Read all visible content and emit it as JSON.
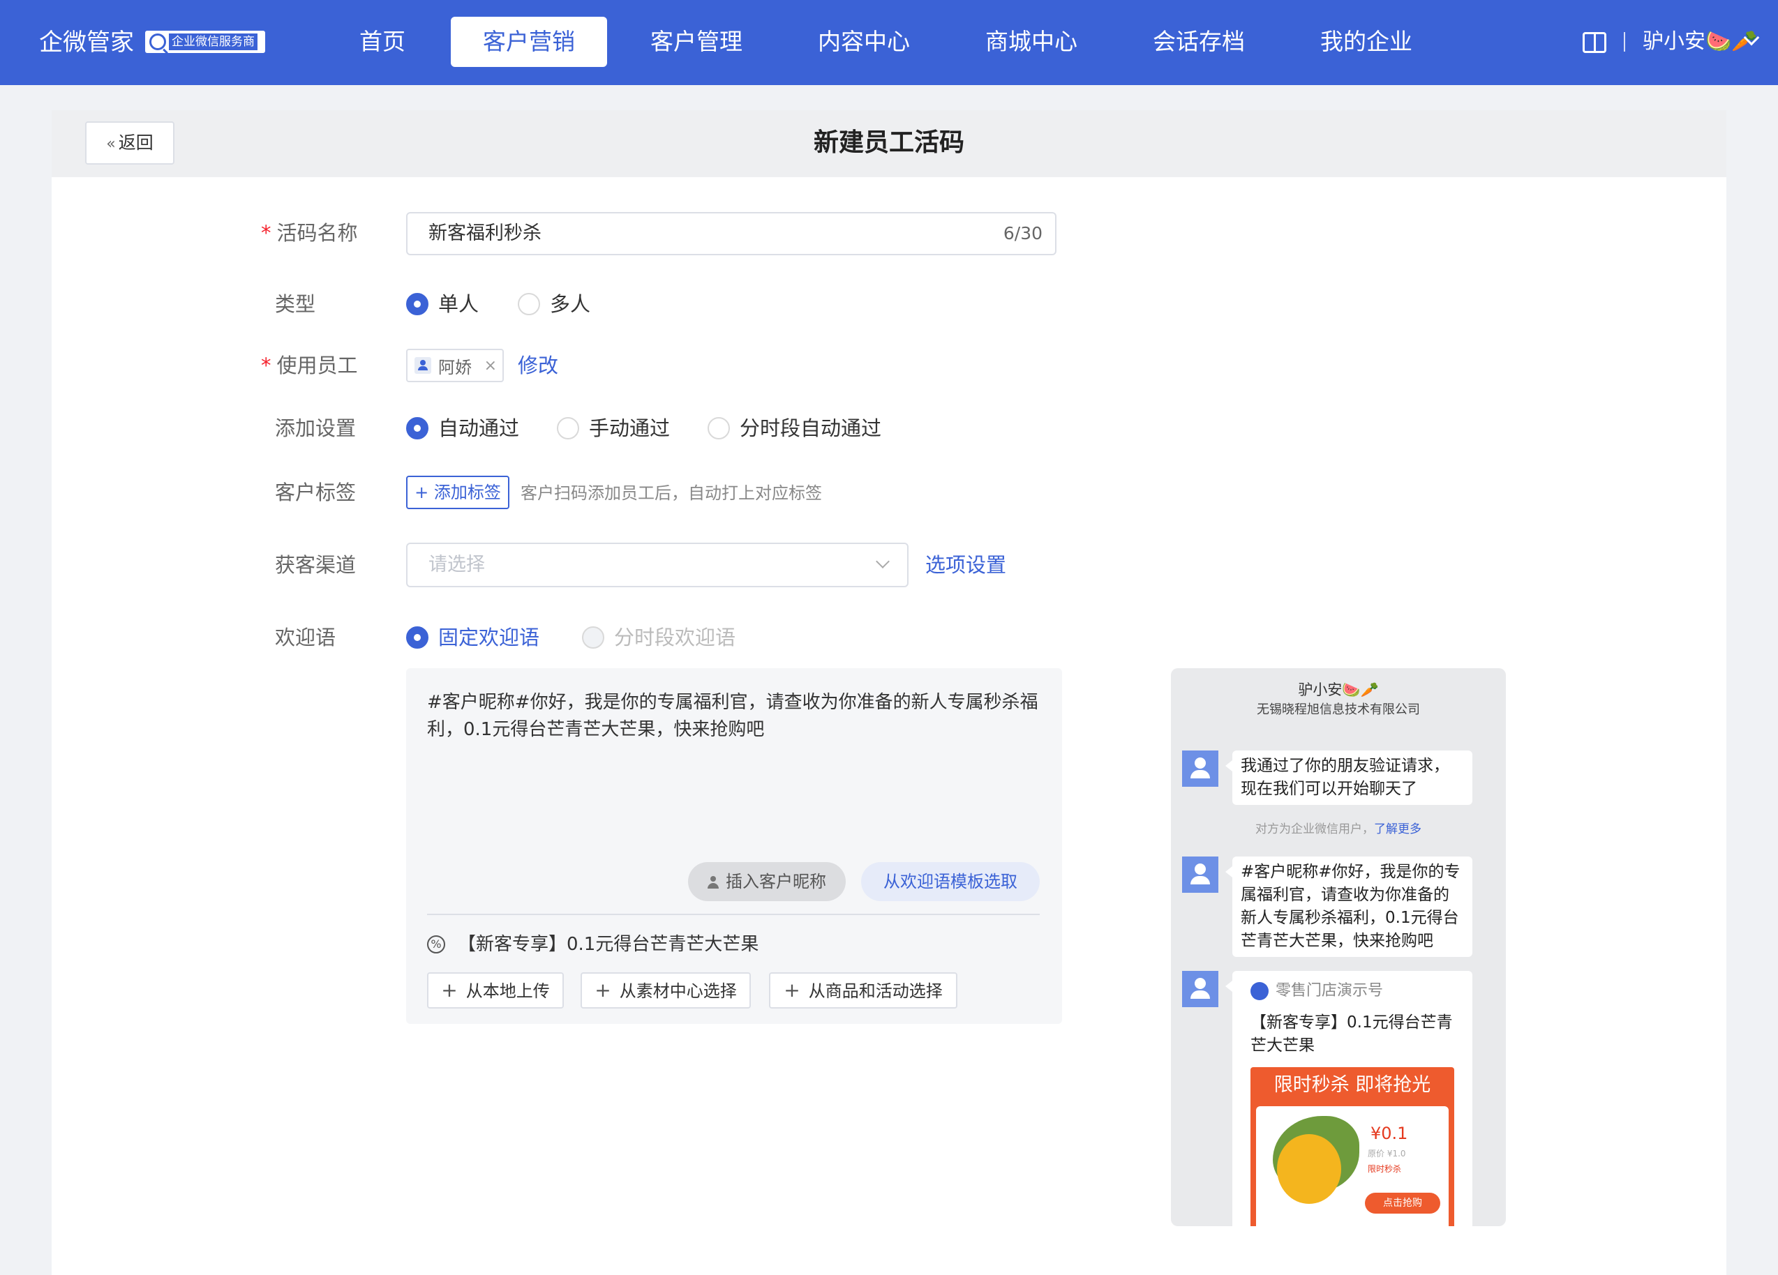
{
  "topbar": {
    "brand": "企微管家",
    "badge": "企业微信服务商",
    "tabs": [
      "首页",
      "客户营销",
      "客户管理",
      "内容中心",
      "商城中心",
      "会话存档",
      "我的企业"
    ],
    "active_tab": "客户营销",
    "user": "驴小安🍉🥕"
  },
  "page": {
    "back_label": "返回",
    "title": "新建员工活码"
  },
  "form": {
    "name": {
      "label": "活码名称",
      "value": "新客福利秒杀",
      "counter": "6/30"
    },
    "type": {
      "label": "类型",
      "options": [
        "单人",
        "多人"
      ],
      "selected": "单人"
    },
    "staff": {
      "label": "使用员工",
      "chip": "阿娇",
      "edit_link": "修改"
    },
    "add_setting": {
      "label": "添加设置",
      "options": [
        "自动通过",
        "手动通过",
        "分时段自动通过"
      ],
      "selected": "自动通过"
    },
    "tags": {
      "label": "客户标签",
      "button": "添加标签",
      "hint": "客户扫码添加员工后，自动打上对应标签"
    },
    "channel": {
      "label": "获客渠道",
      "placeholder": "请选择",
      "link": "选项设置"
    },
    "welcome": {
      "label": "欢迎语",
      "options": [
        "固定欢迎语",
        "分时段欢迎语"
      ],
      "selected": "固定欢迎语",
      "text": "#客户昵称#你好，我是你的专属福利官，请查收为你准备的新人专属秒杀福利，0.1元得台芒青芒大芒果，快来抢购吧",
      "insert_nickname": "插入客户昵称",
      "from_template": "从欢迎语模板选取",
      "attachment": "【新客专享】0.1元得台芒青芒大芒果",
      "upload_buttons": [
        "从本地上传",
        "从素材中心选择",
        "从商品和活动选择"
      ]
    }
  },
  "preview": {
    "name": "驴小安🍉🥕",
    "company": "无锡晓程旭信息技术有限公司",
    "msg1": "我通过了你的朋友验证请求，现在我们可以开始聊天了",
    "sys_note": "对方为企业微信用户，",
    "sys_link": "了解更多",
    "msg2": "#客户昵称#你好，我是你的专属福利官，请查收为你准备的新人专属秒杀福利，0.1元得台芒青芒大芒果，快来抢购吧",
    "mini_source": "零售门店演示号",
    "mini_title": "【新客专享】0.1元得台芒青芒大芒果",
    "promo_header": "限时秒杀  即将抢光",
    "promo_price": "¥0.1",
    "promo_orig": "原价 ¥1.0",
    "promo_flash": "限时秒杀",
    "promo_buy": "点击抢购"
  }
}
